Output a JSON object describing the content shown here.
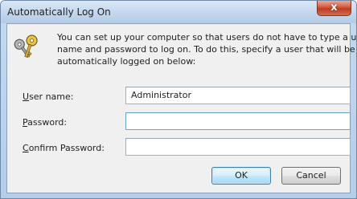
{
  "window": {
    "title": "Automatically Log On",
    "close_label": "x"
  },
  "icon": "keys-icon",
  "description": {
    "lines": [
      "You can set up your computer so that users do not have to type a user",
      "name and password to log on. To do this, specify a user that will be",
      "automatically logged on below:"
    ]
  },
  "fields": {
    "username": {
      "label_accel": "U",
      "label_rest": "ser name:",
      "value": "Administrator"
    },
    "password": {
      "label_accel": "P",
      "label_rest": "assword:",
      "value": ""
    },
    "confirm": {
      "label_accel": "C",
      "label_rest": "onfirm Password:",
      "value": ""
    }
  },
  "buttons": {
    "ok": "OK",
    "cancel": "Cancel"
  },
  "colors": {
    "title_bar": "#c4d8ef",
    "close_button": "#c3391c",
    "client_bg": "#f0f0f0",
    "default_button_border": "#3c7fb1"
  }
}
